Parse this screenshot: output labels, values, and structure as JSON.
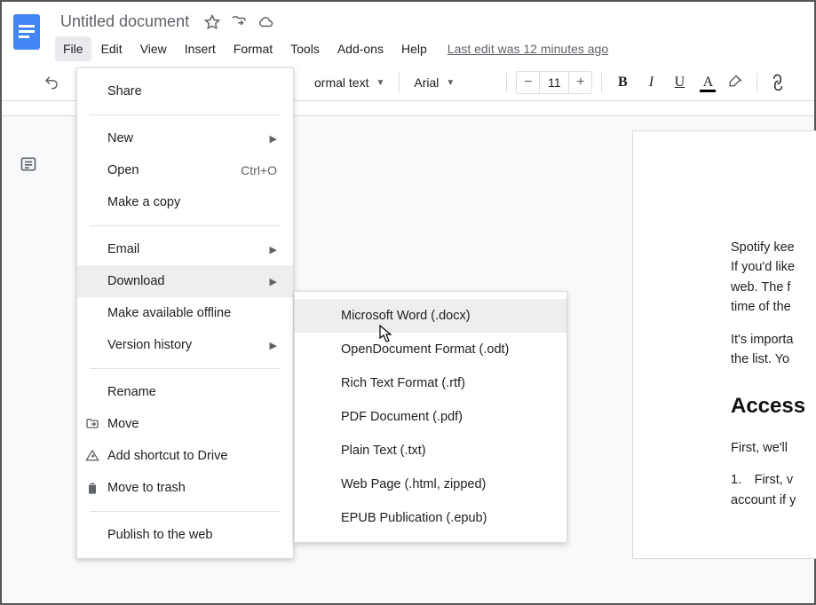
{
  "title": "Untitled document",
  "last_edit": "Last edit was 12 minutes ago",
  "menubar": {
    "file": "File",
    "edit": "Edit",
    "view": "View",
    "insert": "Insert",
    "format": "Format",
    "tools": "Tools",
    "addons": "Add-ons",
    "help": "Help"
  },
  "toolbar": {
    "style": "ormal text",
    "font": "Arial",
    "font_size": "11"
  },
  "file_menu": {
    "share": "Share",
    "new": "New",
    "open": "Open",
    "open_shortcut": "Ctrl+O",
    "make_copy": "Make a copy",
    "email": "Email",
    "download": "Download",
    "make_offline": "Make available offline",
    "version_history": "Version history",
    "rename": "Rename",
    "move": "Move",
    "add_shortcut": "Add shortcut to Drive",
    "move_trash": "Move to trash",
    "publish": "Publish to the web"
  },
  "download_submenu": {
    "docx": "Microsoft Word (.docx)",
    "odt": "OpenDocument Format (.odt)",
    "rtf": "Rich Text Format (.rtf)",
    "pdf": "PDF Document (.pdf)",
    "txt": "Plain Text (.txt)",
    "html": "Web Page (.html, zipped)",
    "epub": "EPUB Publication (.epub)"
  },
  "doc": {
    "p1": "Spotify kee",
    "p2": "If you'd like",
    "p3": "web. The f",
    "p4": "time of the",
    "p5": "It's importa",
    "p6": "the list. Yo",
    "h1": "Access",
    "p7": "First, we'll",
    "p8": "1. First, v",
    "p9": "account if y"
  }
}
